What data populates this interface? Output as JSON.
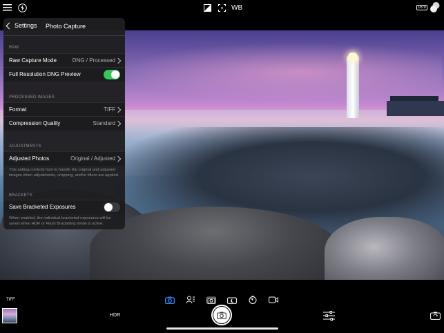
{
  "topbar": {
    "menu_icon": "hamburger-menu-icon",
    "flash_icon": "flash-icon",
    "exposure_icon": "exposure-icon",
    "focus_icon": "focus-target-icon",
    "wb_label": "WB",
    "aspect_label": "16:9",
    "lens_icon": "dual-lens-icon"
  },
  "panel": {
    "back_label": "Settings",
    "title": "Photo Capture",
    "sections": {
      "raw": "RAW",
      "processed": "PROCESSED IMAGES",
      "adjustments": "ADJUSTMENTS",
      "brackets": "BRACKETS"
    },
    "rows": {
      "raw_capture_mode": {
        "label": "Raw Capture Mode",
        "value": "DNG / Processed"
      },
      "full_res_dng": {
        "label": "Full Resolution DNG Preview",
        "state": "on"
      },
      "format": {
        "label": "Format",
        "value": "TIFF"
      },
      "compression": {
        "label": "Compression Quality",
        "value": "Standard"
      },
      "adjusted_photos": {
        "label": "Adjusted Photos",
        "value": "Original / Adjusted"
      },
      "save_bracketed": {
        "label": "Save Bracketed Exposures",
        "state": "off"
      }
    },
    "notes": {
      "adjusted": "This setting controls how to handle the original and adjusted images when adjustments, cropping, and/or filters are applied.",
      "brackets": "When enabled, the individual bracketed exposures will be saved when HDR or Flash Bracketing mode is active."
    }
  },
  "bottombar": {
    "format_badge": "TIFF",
    "hdr_label": "HDR",
    "modes": [
      "camera-mode-icon",
      "portrait-mode-icon",
      "burst-mode-icon",
      "night-mode-icon",
      "timer-mode-icon",
      "video-mode-icon"
    ],
    "shutter_icon": "camera-shutter-icon",
    "adjust_icon": "sliders-icon",
    "flip_icon": "flip-camera-icon"
  },
  "colors": {
    "accent": "#34c759",
    "active_mode": "#2f8cff"
  }
}
